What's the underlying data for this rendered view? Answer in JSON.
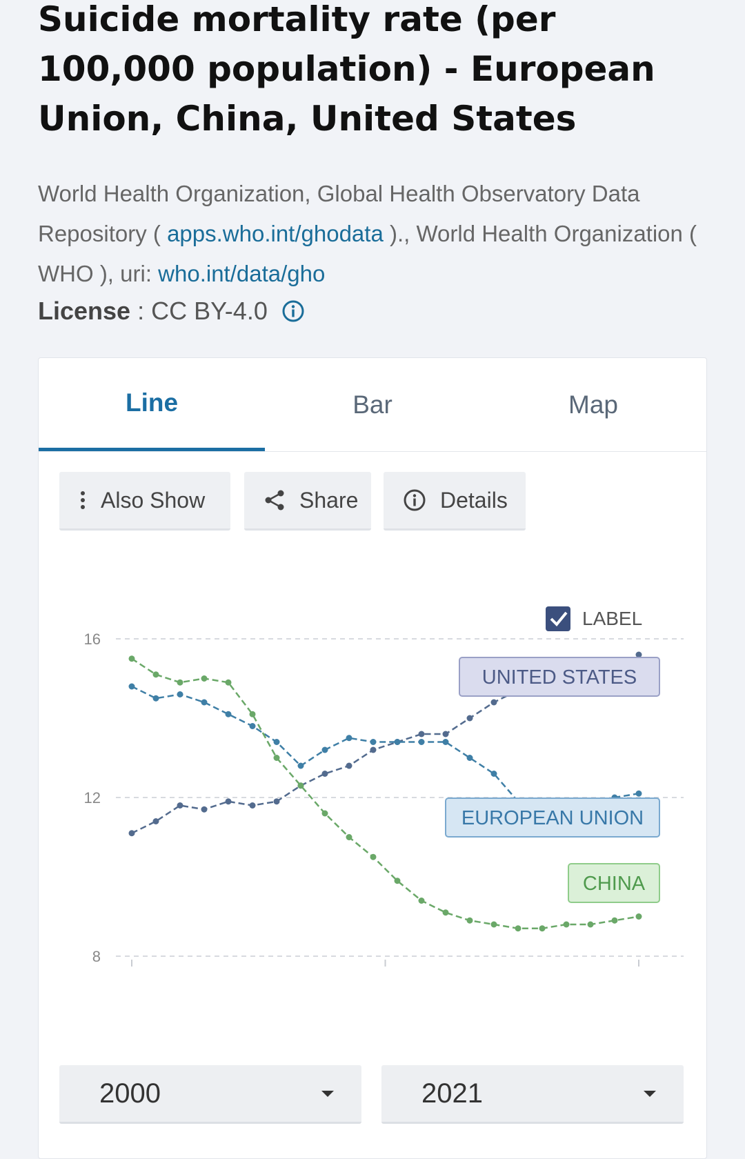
{
  "page": {
    "title": "Suicide mortality rate (per 100,000 population) - European Union, China, United States",
    "source_text_1": "World Health Organization, Global Health Observatory Data Repository ( ",
    "source_link_1": "apps.who.int/ghodata",
    "source_text_2": " )., World Health Organization ( WHO ), uri: ",
    "source_link_2": "who.int/data/gho",
    "license_label": "License",
    "license_value": "CC BY-4.0"
  },
  "tabs": [
    {
      "label": "Line",
      "active": true
    },
    {
      "label": "Bar",
      "active": false
    },
    {
      "label": "Map",
      "active": false
    }
  ],
  "toolbar": {
    "also_show": "Also Show",
    "share": "Share",
    "details": "Details"
  },
  "label_toggle": {
    "label": "LABEL",
    "checked": true
  },
  "range": {
    "start": "2000",
    "end": "2021"
  },
  "chart_data": {
    "type": "line",
    "title": "",
    "xlabel": "",
    "ylabel": "",
    "ylim": [
      8,
      16
    ],
    "yticks": [
      8,
      12,
      16
    ],
    "xlim": [
      2000,
      2021
    ],
    "grid": true,
    "x": [
      2000,
      2001,
      2002,
      2003,
      2004,
      2005,
      2006,
      2007,
      2008,
      2009,
      2010,
      2011,
      2012,
      2013,
      2014,
      2015,
      2016,
      2017,
      2018,
      2019,
      2020,
      2021
    ],
    "series": [
      {
        "name": "UNITED STATES",
        "color": "#536b8e",
        "label_bg": "#dadcee",
        "label_border": "#9aa0c6",
        "label_text_color": "#4c5a86",
        "values": [
          11.1,
          11.4,
          11.8,
          11.7,
          11.9,
          11.8,
          11.9,
          12.3,
          12.6,
          12.8,
          13.2,
          13.4,
          13.6,
          13.6,
          14.0,
          14.4,
          14.7,
          15.0,
          15.3,
          15.1,
          15.0,
          15.6
        ]
      },
      {
        "name": "EUROPEAN UNION",
        "color": "#3f7fa6",
        "label_bg": "#d6e6f3",
        "label_border": "#7aa9cf",
        "label_text_color": "#3878a8",
        "values": [
          14.8,
          14.5,
          14.6,
          14.4,
          14.1,
          13.8,
          13.4,
          12.8,
          13.2,
          13.5,
          13.4,
          13.4,
          13.4,
          13.4,
          13.0,
          12.6,
          11.9,
          11.9,
          11.9,
          11.7,
          12.0,
          12.1
        ]
      },
      {
        "name": "CHINA",
        "color": "#6aa868",
        "label_bg": "#dbf0d8",
        "label_border": "#8fcc8a",
        "label_text_color": "#4f9a4d",
        "values": [
          15.5,
          15.1,
          14.9,
          15.0,
          14.9,
          14.1,
          13.0,
          12.3,
          11.6,
          11.0,
          10.5,
          9.9,
          9.4,
          9.1,
          8.9,
          8.8,
          8.7,
          8.7,
          8.8,
          8.8,
          8.9,
          9.0
        ]
      }
    ]
  }
}
